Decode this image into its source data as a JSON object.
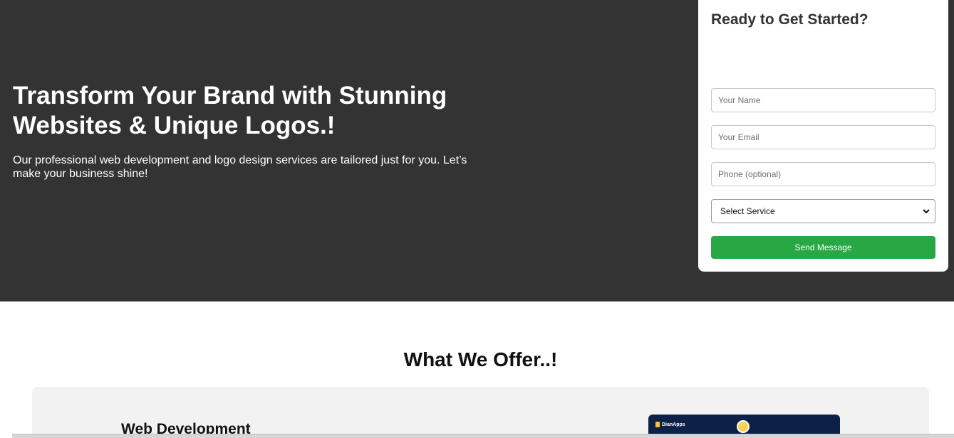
{
  "hero": {
    "title": "Transform Your Brand with Stunning Websites & Unique Logos.!",
    "subtitle": "Our professional web development and logo design services are tailored just for you. Let’s make your business shine!"
  },
  "form": {
    "title": "Ready to Get Started?",
    "name_placeholder": "Your Name",
    "email_placeholder": "Your Email",
    "phone_placeholder": "Phone (optional)",
    "service_selected": "Select Service",
    "submit_label": "Send Message"
  },
  "offers": {
    "title": "What We Offer..!",
    "items": [
      {
        "title": "Web Development",
        "image_brand": "DianApps"
      }
    ]
  },
  "colors": {
    "hero_bg": "#333333",
    "accent_green": "#28a745",
    "card_bg": "#f2f2f2"
  },
  "icons": {
    "select_chevron": "chevron-down-icon"
  }
}
